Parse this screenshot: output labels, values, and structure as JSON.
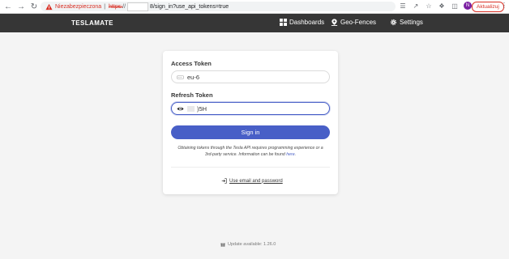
{
  "browser": {
    "insecure_label": "Niezabezpieczona",
    "url_scheme": "https:",
    "url_slashes": "//",
    "url_path": "8/sign_in?use_api_tokens=true",
    "update_label": "Aktualizuj",
    "profile_initial": "N"
  },
  "navbar": {
    "brand": "TESLAMATE",
    "dashboards": "Dashboards",
    "geofences": "Geo-Fences",
    "settings": "Settings"
  },
  "form": {
    "access_token_label": "Access Token",
    "access_token_value": "eu-6",
    "refresh_token_label": "Refresh Token",
    "refresh_token_value": ")5H",
    "signin_label": "Sign in",
    "help_text": "Obtaining tokens through the Tesla API requires programming experience or a 3rd-party service. Information can be found",
    "help_link": "here",
    "help_end": ".",
    "alt_link": "Use email and password"
  },
  "footer": {
    "update_text": "Update available: 1.26.0"
  },
  "colors": {
    "navbar": "#363636",
    "primary": "#485fc7",
    "insecure": "#d93025"
  }
}
